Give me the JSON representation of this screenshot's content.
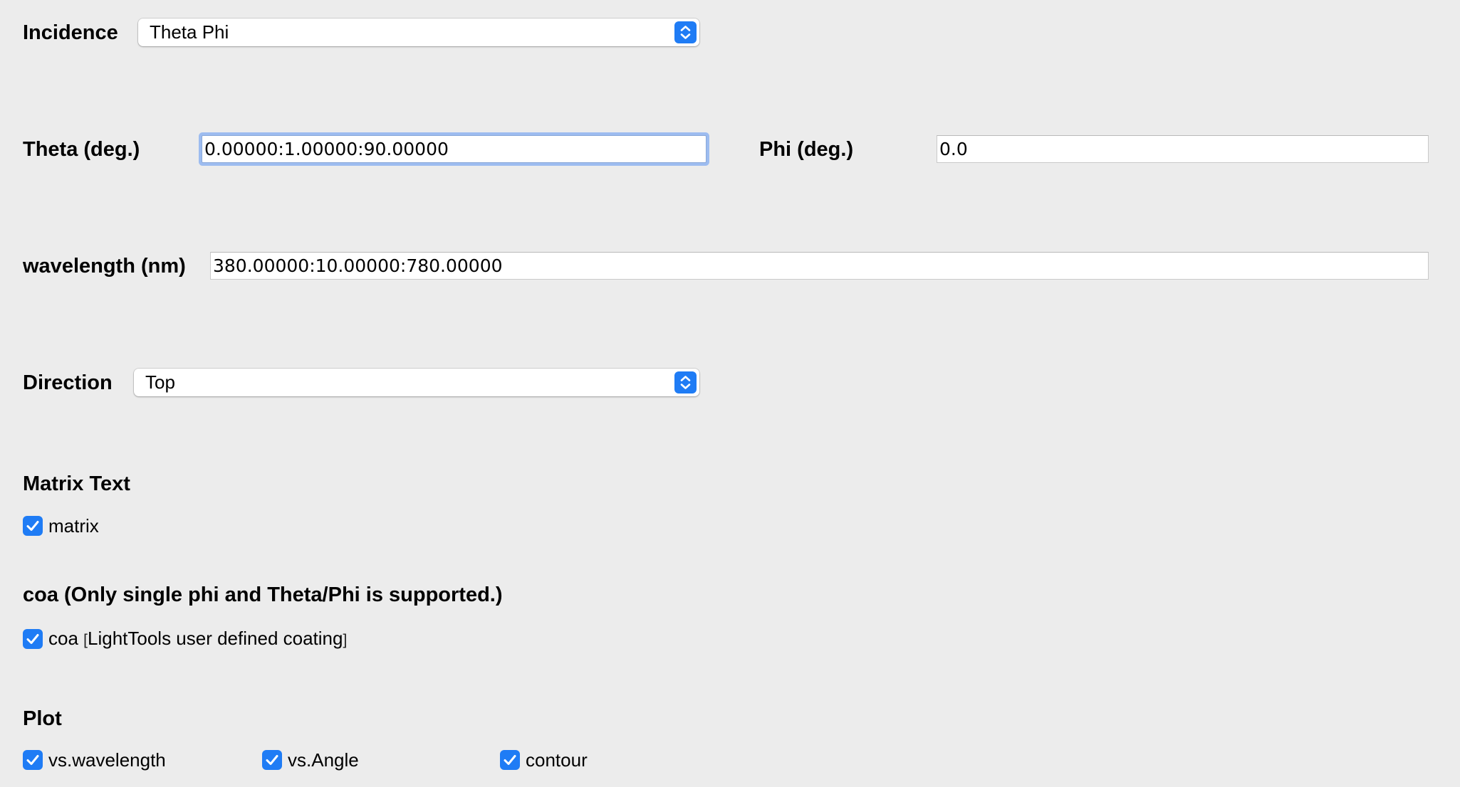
{
  "incidence": {
    "label": "Incidence",
    "selected": "Theta Phi"
  },
  "theta": {
    "label": "Theta (deg.)",
    "value": "0.00000:1.00000:90.00000"
  },
  "phi": {
    "label": "Phi (deg.)",
    "value": "0.0"
  },
  "wavelength": {
    "label": "wavelength (nm)",
    "value": "380.00000:10.00000:780.00000"
  },
  "direction": {
    "label": "Direction",
    "selected": "Top"
  },
  "matrix_section": {
    "title": "Matrix Text",
    "checkbox_label": "matrix",
    "checked": true
  },
  "coa_section": {
    "title": "coa (Only single phi and Theta/Phi is supported.)",
    "checkbox_label": "coa",
    "bracket_open": "[",
    "checkbox_note": "LightTools user defined coating",
    "bracket_close": "]",
    "checked": true
  },
  "plot_section": {
    "title": "Plot",
    "options": [
      {
        "label": "vs.wavelength",
        "checked": true
      },
      {
        "label": "vs.Angle",
        "checked": true
      },
      {
        "label": "contour",
        "checked": true
      }
    ]
  },
  "colors": {
    "background": "#ececec",
    "accent": "#1f7cf5",
    "focus_ring": "#9dbcf0"
  }
}
